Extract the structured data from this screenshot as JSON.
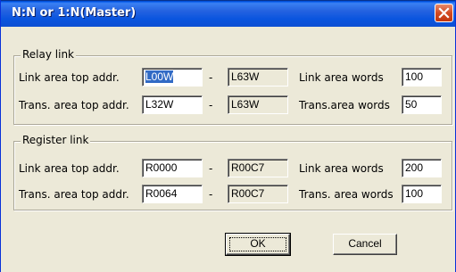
{
  "window": {
    "title": "N:N or 1:N(Master)"
  },
  "relay_link": {
    "legend": "Relay link",
    "link_area_top_label": "Link area top addr.",
    "link_area_top_value": "L00W",
    "link_area_end_value": "L63W",
    "link_area_words_label": "Link area words",
    "link_area_words_value": "100",
    "trans_area_top_label": "Trans. area top addr.",
    "trans_area_top_value": "L32W",
    "trans_area_end_value": "L63W",
    "trans_area_words_label": "Trans.area words",
    "trans_area_words_value": "50",
    "dash": "-"
  },
  "register_link": {
    "legend": "Register link",
    "link_area_top_label": "Link area top addr.",
    "link_area_top_value": "R0000",
    "link_area_end_value": "R00C7",
    "link_area_words_label": "Link area words",
    "link_area_words_value": "200",
    "trans_area_top_label": "Trans. area top addr.",
    "trans_area_top_value": "R0064",
    "trans_area_end_value": "R00C7",
    "trans_area_words_label": "Trans. area words",
    "trans_area_words_value": "100",
    "dash": "-"
  },
  "buttons": {
    "ok": "OK",
    "cancel": "Cancel"
  },
  "icons": {
    "close": "close-icon"
  },
  "colors": {
    "title_bar": "#0a55df",
    "close_button": "#c2360e",
    "dialog_bg": "#ece9d8",
    "selection": "#316ac5"
  }
}
